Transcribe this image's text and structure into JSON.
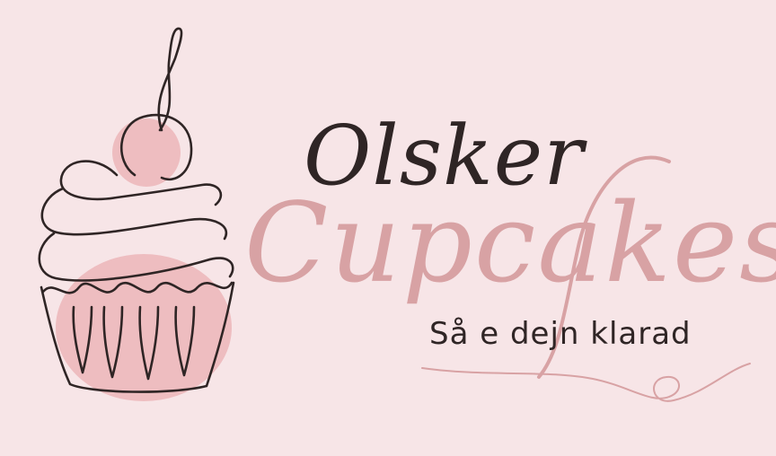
{
  "logo": {
    "brand_name_line1": "Olsker",
    "brand_name_line2": "Cupcakes",
    "tagline": "Så e dejn klarad"
  },
  "colors": {
    "background": "#f7e5e7",
    "ink": "#2f2525",
    "accent": "#d8a2a4",
    "fill": "#eebdc0"
  },
  "icons": {
    "main": "cupcake-line-art-icon",
    "decoration": "flourish-swash"
  }
}
